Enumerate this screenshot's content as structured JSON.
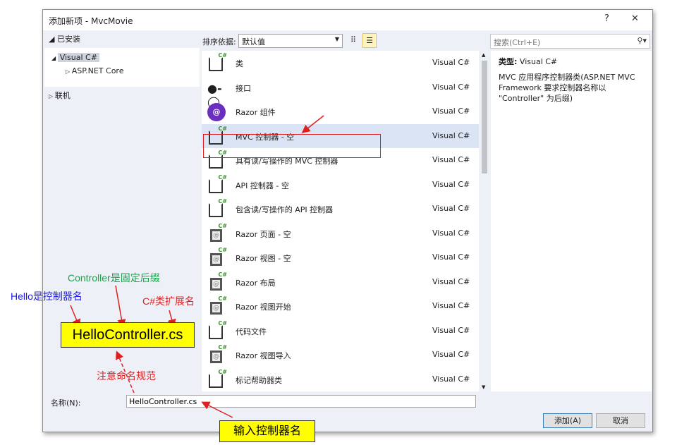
{
  "window": {
    "title": "添加新项 - MvcMovie",
    "help": "?",
    "close": "✕"
  },
  "left": {
    "installed": "已安装",
    "visual_csharp": "Visual C#",
    "aspnet_core": "ASP.NET Core",
    "online": "联机"
  },
  "sort": {
    "label": "排序依据:",
    "value": "默认值"
  },
  "search": {
    "placeholder": "搜索(Ctrl+E)"
  },
  "items": [
    {
      "name": "类",
      "lang": "Visual C#",
      "icon": "class-icon"
    },
    {
      "name": "接口",
      "lang": "Visual C#",
      "icon": "interface-icon"
    },
    {
      "name": "Razor 组件",
      "lang": "Visual C#",
      "icon": "razor-component-icon"
    },
    {
      "name": "MVC 控制器 - 空",
      "lang": "Visual C#",
      "icon": "class-icon"
    },
    {
      "name": "具有读/写操作的 MVC 控制器",
      "lang": "Visual C#",
      "icon": "class-icon"
    },
    {
      "name": "API 控制器 - 空",
      "lang": "Visual C#",
      "icon": "class-icon"
    },
    {
      "name": "包含读/写操作的 API 控制器",
      "lang": "Visual C#",
      "icon": "class-icon"
    },
    {
      "name": "Razor 页面 - 空",
      "lang": "Visual C#",
      "icon": "razor-page-icon"
    },
    {
      "name": "Razor 视图 - 空",
      "lang": "Visual C#",
      "icon": "razor-page-icon"
    },
    {
      "name": "Razor 布局",
      "lang": "Visual C#",
      "icon": "razor-page-icon"
    },
    {
      "name": "Razor 视图开始",
      "lang": "Visual C#",
      "icon": "razor-page-icon"
    },
    {
      "name": "代码文件",
      "lang": "Visual C#",
      "icon": "code-file-icon"
    },
    {
      "name": "Razor 视图导入",
      "lang": "Visual C#",
      "icon": "razor-page-icon"
    },
    {
      "name": "标记帮助器类",
      "lang": "Visual C#",
      "icon": "class-icon"
    }
  ],
  "selected_index": 3,
  "details": {
    "type_label": "类型:",
    "type_value": "Visual C#",
    "description": "MVC 应用程序控制器类(ASP.NET MVC Framework 要求控制器名称以 \"Controller\" 为后缀)"
  },
  "bottom": {
    "name_label": "名称(N):",
    "name_value": "HelloController.cs",
    "add": "添加(A)",
    "cancel": "取消"
  },
  "annotations": {
    "suffix": "Controller是固定后缀",
    "controller_name": "Hello是控制器名",
    "extension": "C#类扩展名",
    "big_filename": "HelloController.cs",
    "naming": "注意命名规范",
    "enter_name": "输入控制器名",
    "colors": {
      "suffix": "#1aa34a",
      "controller_name": "#1a1ae0",
      "red": "#e02020",
      "highlight": "#ffff00"
    }
  }
}
